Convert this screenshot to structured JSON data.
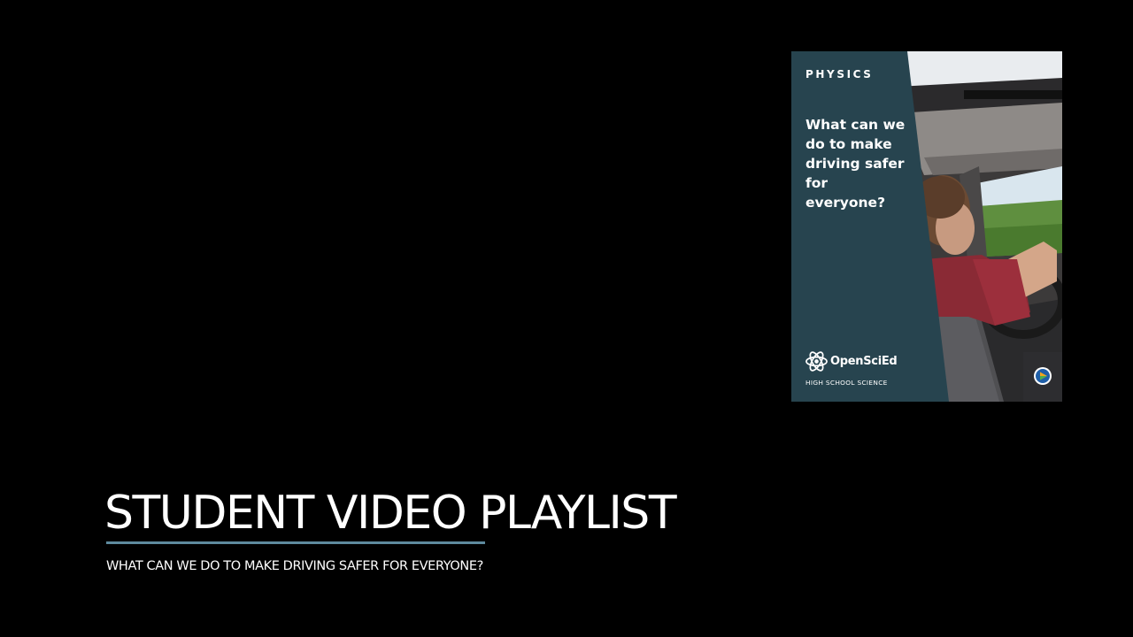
{
  "slide": {
    "title": "STUDENT VIDEO PLAYLIST",
    "subtitle": "WHAT CAN WE DO TO MAKE DRIVING SAFER FOR EVERYONE?"
  },
  "cover": {
    "subject": "PHYSICS",
    "question": "What can we do to make driving safer for everyone?",
    "brand_name": "OpenSciEd",
    "brand_subtitle": "HIGH SCHOOL SCIENCE",
    "brand_icon": "atom-icon",
    "badge_icon": "play-badge-icon",
    "panel_color": "#27444f"
  },
  "colors": {
    "background": "#000000",
    "accent_underline": "#5e8a9e",
    "text": "#ffffff"
  }
}
